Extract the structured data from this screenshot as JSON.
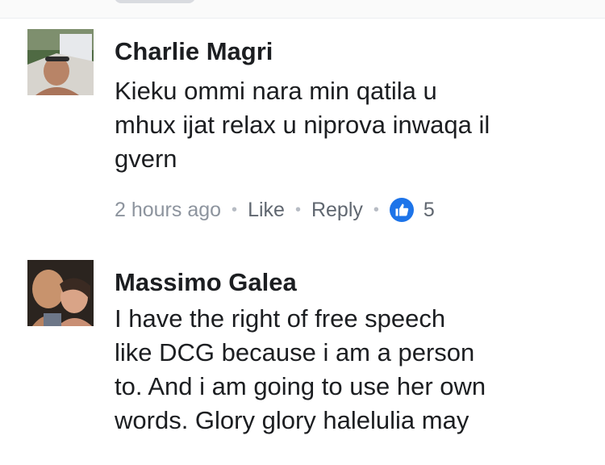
{
  "comments": [
    {
      "author": "Charlie Magri",
      "lines": [
        "Kieku ommi nara min qatila u",
        "mhux ijat relax u niprova inwaqa il",
        "gvern"
      ],
      "time": "2 hours ago",
      "like_label": "Like",
      "reply_label": "Reply",
      "reaction_icon": "thumbs-up-icon",
      "reaction_count": "5"
    },
    {
      "author": "Massimo Galea",
      "lines": [
        "I have the right of free speech",
        "like DCG because i am a person",
        "to. And i am going to use her own",
        "words. Glory glory halelulia may"
      ]
    }
  ],
  "colors": {
    "name": "#1c1e21",
    "meta": "#8d949e",
    "link": "#606770",
    "reaction_blue": "#1d74e9"
  }
}
